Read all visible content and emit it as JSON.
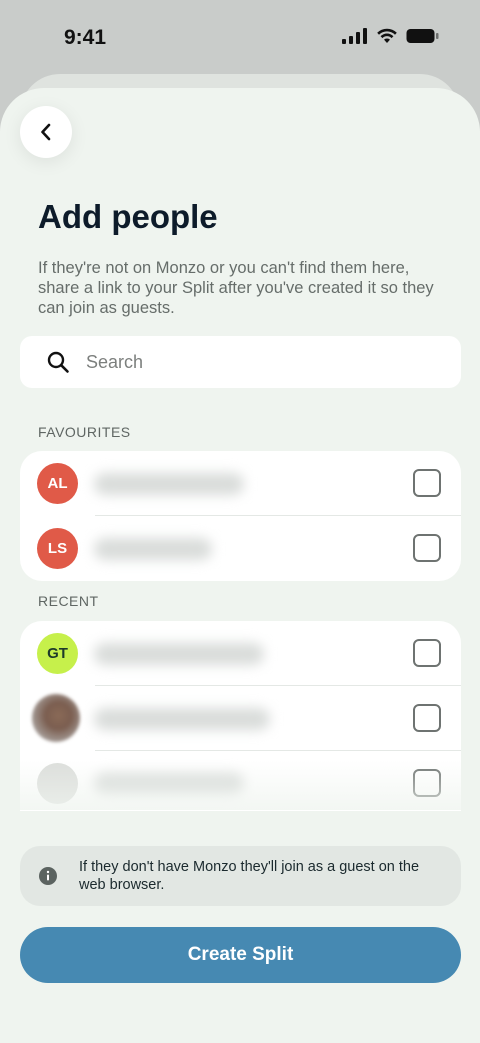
{
  "status": {
    "time": "9:41"
  },
  "header": {
    "title": "Add people",
    "subtitle": "If they're not on Monzo or you can't find them here, share a link to your Split after you've created it so they can join as guests."
  },
  "search": {
    "placeholder": "Search",
    "value": ""
  },
  "sections": {
    "favourites_label": "FAVOURITES",
    "recent_label": "RECENT"
  },
  "favourites": [
    {
      "initials": "AL",
      "color": "#e05a48",
      "text_color": "#ffffff",
      "checked": false
    },
    {
      "initials": "LS",
      "color": "#e05a48",
      "text_color": "#ffffff",
      "checked": false
    }
  ],
  "recent": [
    {
      "initials": "GT",
      "color": "#c6f04b",
      "text_color": "#1e3a2a",
      "checked": false
    },
    {
      "initials": "",
      "photo": true,
      "checked": false
    },
    {
      "initials": "",
      "color": "#dcdedb",
      "checked": false
    }
  ],
  "info": {
    "text": "If they don't have Monzo they'll join as a guest on the web browser."
  },
  "cta": {
    "label": "Create Split",
    "color": "#4689b2"
  }
}
